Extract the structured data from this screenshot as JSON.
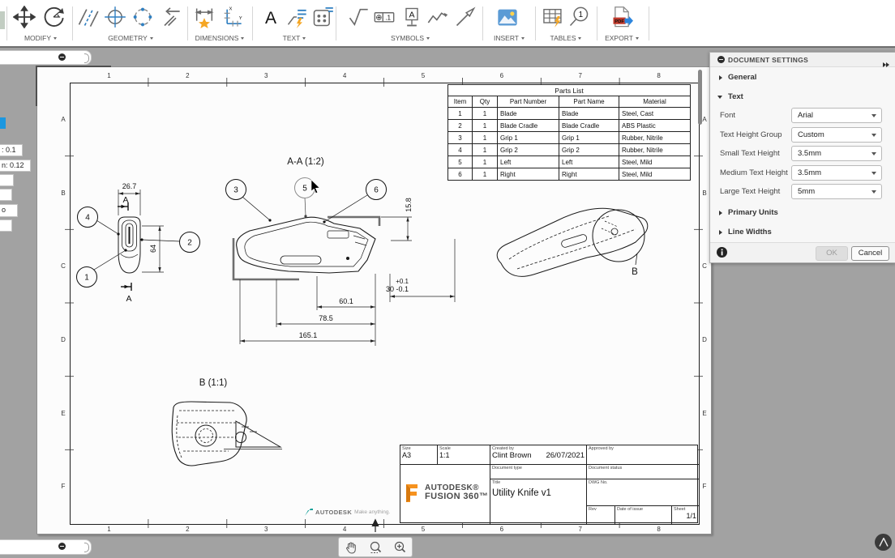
{
  "toolbar": {
    "groups": [
      {
        "label": "MODIFY"
      },
      {
        "label": "GEOMETRY"
      },
      {
        "label": "DIMENSIONS"
      },
      {
        "label": "TEXT"
      },
      {
        "label": "SYMBOLS"
      },
      {
        "label": "INSERT"
      },
      {
        "label": "TABLES"
      },
      {
        "label": "EXPORT"
      }
    ],
    "icon_texts": {
      "text_tool": "A",
      "fcf_circle": "⊕",
      "fcf_value": ".1",
      "datum": "A",
      "ordinate_x": "X",
      "ordinate_y": "Y",
      "balloon": "1",
      "pdf": "PDF"
    }
  },
  "left_fragments": {
    "label_1": ": 0.1",
    "label_2": "n: 0.12",
    "label_3": "o"
  },
  "sheet": {
    "columns": [
      "1",
      "2",
      "3",
      "4",
      "5",
      "6",
      "7",
      "8"
    ],
    "rows": [
      "A",
      "B",
      "C",
      "D",
      "E",
      "F"
    ],
    "watermark_brand": "AUTODESK",
    "watermark_tagline": "Make anything."
  },
  "parts_list": {
    "title": "Parts List",
    "headers": [
      "Item",
      "Qty",
      "Part Number",
      "Part Name",
      "Material"
    ],
    "rows": [
      [
        "1",
        "1",
        "Blade",
        "Blade",
        "Steel, Cast"
      ],
      [
        "2",
        "1",
        "Blade Cradle",
        "Blade Cradle",
        "ABS Plastic"
      ],
      [
        "3",
        "1",
        "Grip 1",
        "Grip 1",
        "Rubber, Nitrile"
      ],
      [
        "4",
        "1",
        "Grip 2",
        "Grip 2",
        "Rubber, Nitrile"
      ],
      [
        "5",
        "1",
        "Left",
        "Left",
        "Steel, Mild"
      ],
      [
        "6",
        "1",
        "Right",
        "Right",
        "Steel, Mild"
      ]
    ]
  },
  "drawing": {
    "section_title": "A-A (1:2)",
    "detail_title": "B (1:1)",
    "detail_label": "B",
    "section_mark": "A",
    "balloons": [
      "1",
      "2",
      "3",
      "4",
      "5",
      "6"
    ],
    "dims": {
      "front_width": "26.7",
      "front_height": "64",
      "blade_height": "15.8",
      "tol_upper": "+0.1",
      "tol_value": "30 -0.1",
      "len1": "60.1",
      "len2": "78.5",
      "len3": "165.1"
    }
  },
  "title_block": {
    "size_label": "Size",
    "size": "A3",
    "scale_label": "Scale",
    "scale": "1:1",
    "created_label": "Created by",
    "created_by": "Clint Brown",
    "created_date": "26/07/2021",
    "approved_label": "Approved by",
    "doc_type_label": "Document type",
    "doc_status_label": "Document status",
    "title_label": "Title",
    "title": "Utility Knife v1",
    "dwg_label": "DWG No.",
    "rev_label": "Rev",
    "issue_label": "Date of issue",
    "sheet_label": "Sheet",
    "sheet": "1/1",
    "logo_line1": "AUTODESK®",
    "logo_line2": "FUSION 360™"
  },
  "settings_panel": {
    "header": "DOCUMENT SETTINGS",
    "sections": {
      "general": "General",
      "text": "Text",
      "primary_units": "Primary Units",
      "line_widths": "Line Widths"
    },
    "fields": [
      {
        "label": "Font",
        "value": "Arial"
      },
      {
        "label": "Text Height Group",
        "value": "Custom"
      },
      {
        "label": "Small Text Height",
        "value": "3.5mm"
      },
      {
        "label": "Medium Text Height",
        "value": "3.5mm"
      },
      {
        "label": "Large Text Height",
        "value": "5mm"
      }
    ],
    "ok_label": "OK",
    "cancel_label": "Cancel"
  }
}
